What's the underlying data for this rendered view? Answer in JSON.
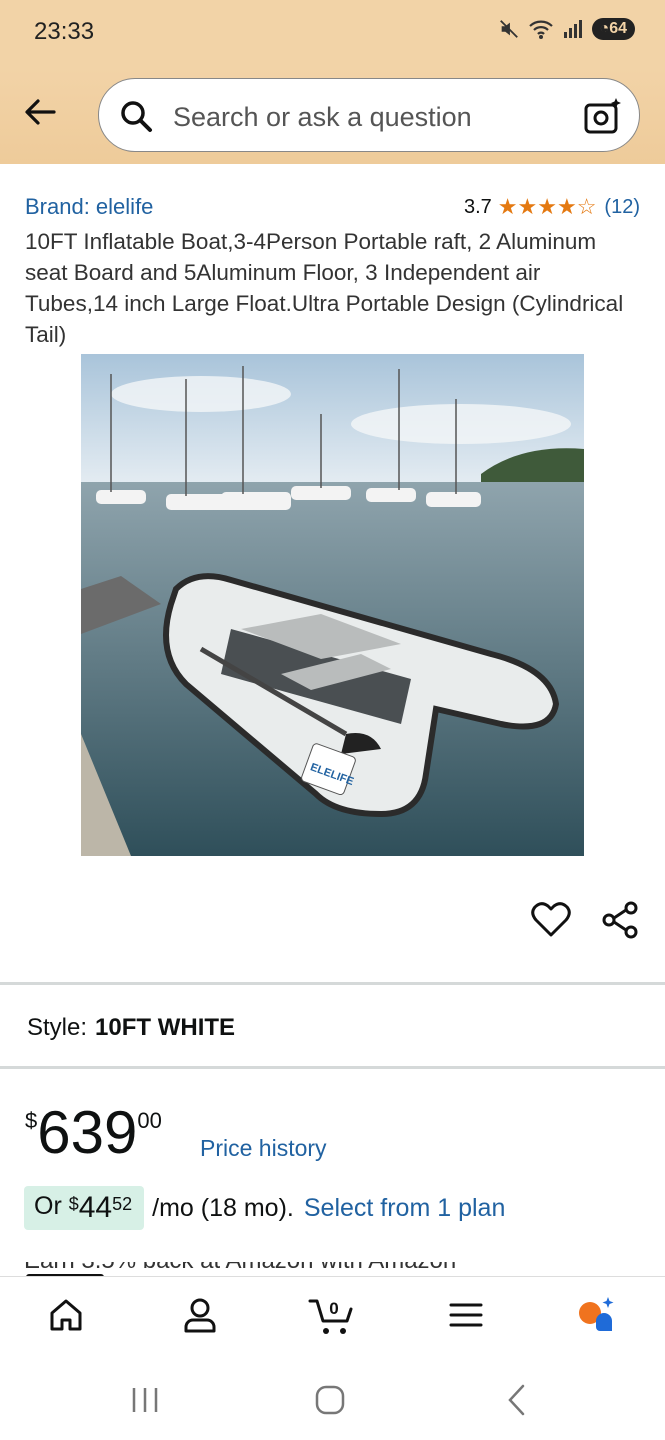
{
  "status": {
    "time": "23:33",
    "battery": "64"
  },
  "search": {
    "placeholder": "Search or ask a question"
  },
  "product": {
    "brand": "Brand: elelife",
    "rating": "3.7",
    "stars": "★★★★☆",
    "review_count": "(12)",
    "title": "10FT Inflatable Boat,3-4Person Portable raft, 2 Aluminum seat Board and 5Aluminum Floor, 3 Independent air Tubes,14 inch Large Float.Ultra Portable Design (Cylindrical Tail)",
    "image_logo": "ELELIFE"
  },
  "style": {
    "label": "Style:",
    "value": "10FT WHITE"
  },
  "price": {
    "currency": "$",
    "whole": "639",
    "fraction": "00",
    "history_link": "Price history"
  },
  "monthly": {
    "prefix": "Or",
    "currency": "$",
    "whole": "44",
    "fraction": "52",
    "term": "/mo (18 mo).",
    "plan_link": "Select from 1 plan"
  },
  "peek": {
    "text": "Earn 3.5% back at Amazon with Amazon"
  },
  "bottom_nav": {
    "cart_count": "0"
  },
  "colors": {
    "header_bg": "#f2d3a7",
    "link": "#2162a1",
    "star": "#e47911",
    "chip": "#d7f0e6"
  }
}
